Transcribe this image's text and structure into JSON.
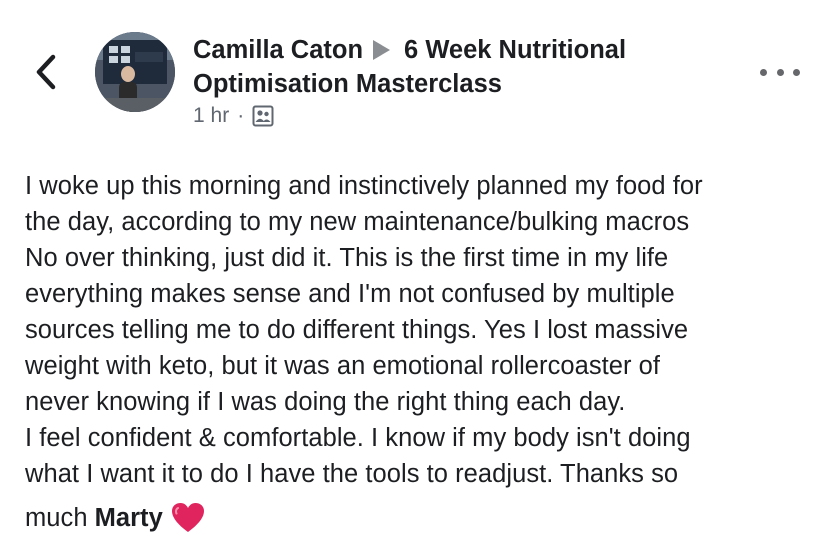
{
  "header": {
    "author": "Camilla Caton",
    "group_line1": "6 Week Nutritional",
    "group_line2": "Optimisation Masterclass",
    "timestamp": "1 hr",
    "separator": "·",
    "back_icon": "chevron-left-icon",
    "privacy_icon": "group-icon",
    "more_icon": "ellipsis-icon"
  },
  "post": {
    "lines": [
      "I woke up this morning and instinctively planned my food for",
      "the day, according to my new maintenance/bulking macros",
      "No over thinking, just did it. This is the first time in my life",
      "everything makes sense and I'm not confused by multiple",
      "sources telling me to do different things. Yes I lost massive",
      "weight with keto, but it was an emotional rollercoaster of",
      "never knowing if I was doing the right thing each day.",
      "I feel confident & comfortable. I know if my body isn't doing",
      "what I want it to do I have the tools to readjust. Thanks so"
    ],
    "last_prefix": "much",
    "mention": "Marty",
    "emoji": "red-heart-icon"
  },
  "colors": {
    "text": "#1c1e21",
    "meta": "#606770",
    "heart": "#e0245e"
  }
}
